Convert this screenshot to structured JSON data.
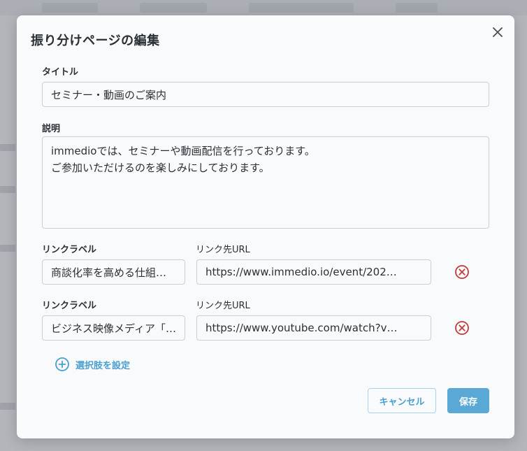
{
  "modal": {
    "title": "振り分けページの編集",
    "close_icon": "close-icon"
  },
  "form": {
    "title_label": "タイトル",
    "title_value": "セミナー・動画のご案内",
    "description_label": "説明",
    "description_lines": [
      "immedioでは、セミナーや動画配信を行っております。",
      "ご参加いただけるのを楽しみにしております。"
    ],
    "links": [
      {
        "label_caption": "リンクラベル",
        "url_caption": "リンク先URL",
        "label_value": "商談化率を高める仕組…",
        "url_value": "https://www.immedio.io/event/202…",
        "remove_icon": "remove-circle-icon"
      },
      {
        "label_caption": "リンクラベル",
        "url_caption": "リンク先URL",
        "label_value": "ビジネス映像メディア「…",
        "url_value": "https://www.youtube.com/watch?v…",
        "remove_icon": "remove-circle-icon"
      }
    ],
    "add_choice_label": "選択肢を設定",
    "add_choice_icon": "add-circle-icon"
  },
  "actions": {
    "cancel_label": "キャンセル",
    "save_label": "保存"
  },
  "colors": {
    "accent": "#5aa8d6",
    "link": "#4a9fd0",
    "danger": "#c0393b"
  }
}
